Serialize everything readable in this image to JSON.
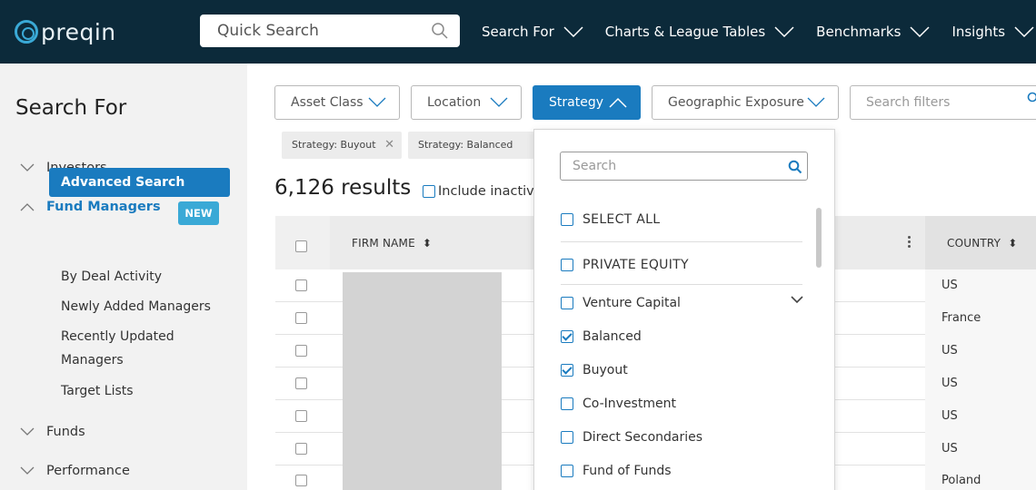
{
  "app": {
    "logo_text": "preqin"
  },
  "topnav": {
    "quick_search_placeholder": "Quick Search",
    "items": [
      {
        "label": "Search For"
      },
      {
        "label": "Charts & League Tables"
      },
      {
        "label": "Benchmarks"
      },
      {
        "label": "Insights"
      }
    ]
  },
  "sidebar": {
    "title": "Search For",
    "groups": {
      "investors": "Investors",
      "fund_managers": "Fund Managers",
      "funds": "Funds",
      "performance": "Performance"
    },
    "sub_items": {
      "advanced_search": "Advanced Search",
      "by_deal_activity": "By Deal Activity",
      "new_badge": "NEW",
      "newly_added": "Newly Added Managers",
      "recently_updated_1": "Recently Updated",
      "recently_updated_2": "Managers",
      "target_lists": "Target Lists"
    }
  },
  "filters": {
    "asset_class": "Asset Class",
    "location": "Location",
    "strategy": "Strategy",
    "geographic_exposure": "Geographic Exposure",
    "search_placeholder": "Search filters",
    "chips": [
      "Strategy: Buyout",
      "Strategy: Balanced"
    ]
  },
  "results": {
    "count_text": "6,126 results",
    "include_inactive": "Include inactive"
  },
  "table": {
    "columns": {
      "firm_name": "FIRM NAME",
      "country": "COUNTRY"
    },
    "rows": [
      {
        "country": "US"
      },
      {
        "country": "France"
      },
      {
        "country": "US"
      },
      {
        "country": "US"
      },
      {
        "country": "US"
      },
      {
        "country": "US"
      },
      {
        "country": "Poland"
      }
    ]
  },
  "strategy_dropdown": {
    "search_placeholder": "Search",
    "select_all": "SELECT ALL",
    "group_label": "PRIVATE EQUITY",
    "options": [
      {
        "label": "Venture Capital",
        "checked": false
      },
      {
        "label": "Balanced",
        "checked": true
      },
      {
        "label": "Buyout",
        "checked": true
      },
      {
        "label": "Co-Investment",
        "checked": false
      },
      {
        "label": "Direct Secondaries",
        "checked": false
      },
      {
        "label": "Fund of Funds",
        "checked": false
      }
    ]
  },
  "colors": {
    "topbar": "#0c2a3a",
    "accent": "#1a7bbf",
    "badge": "#3aa9d6"
  }
}
